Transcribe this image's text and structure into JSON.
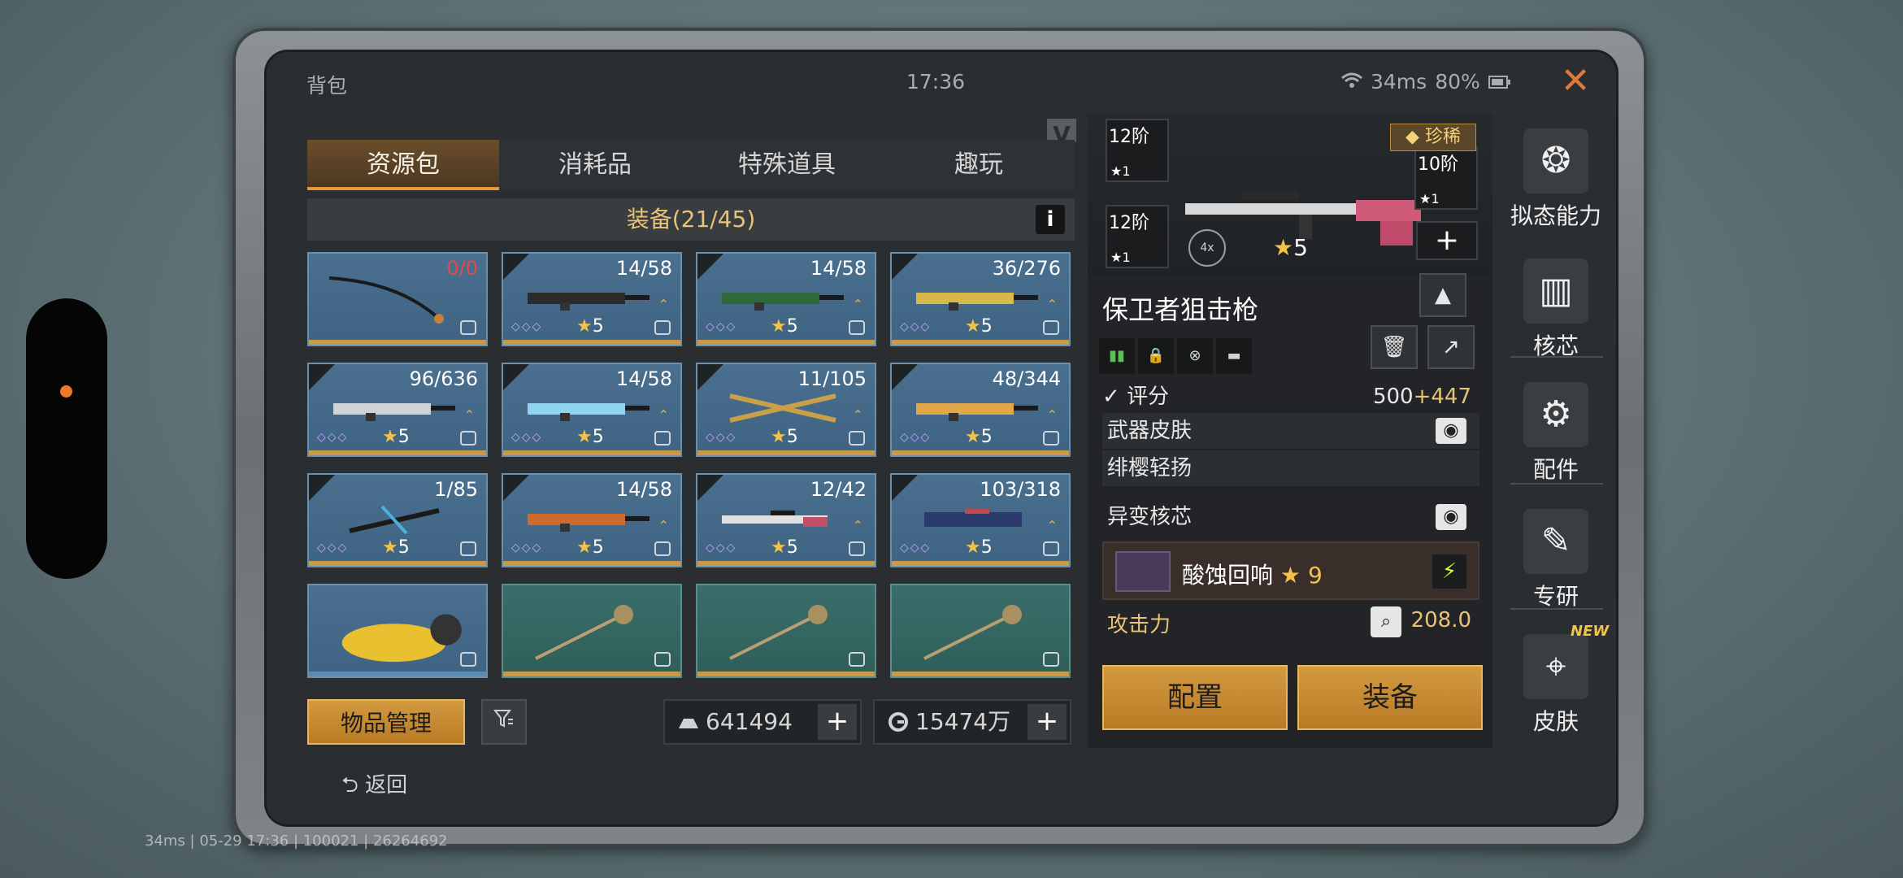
{
  "statusbar": {
    "title": "背包",
    "time": "17:36",
    "ping": "34ms",
    "battery": "80%"
  },
  "icons": {
    "close": "close-icon",
    "wifi": "wifi-icon",
    "battery": "battery-icon",
    "info": "info-icon",
    "filter": "filter-icon",
    "back": "back-arrow-icon",
    "star": "star-icon",
    "lock": "lock-icon"
  },
  "tabs": [
    {
      "label": "资源包",
      "active": true
    },
    {
      "label": "消耗品",
      "active": false
    },
    {
      "label": "特殊道具",
      "active": false
    },
    {
      "label": "趣玩",
      "active": false
    }
  ],
  "equipment_header": "装备(21/45)",
  "info_label": "i",
  "v_badge": "V",
  "items": [
    {
      "count": "0/0",
      "type": "fishing-rod"
    },
    {
      "count": "14/58",
      "stars": "5",
      "type": "rifle"
    },
    {
      "count": "14/58",
      "stars": "5",
      "type": "rifle"
    },
    {
      "count": "36/276",
      "stars": "5",
      "type": "rifle"
    },
    {
      "count": "96/636",
      "stars": "5",
      "type": "rifle"
    },
    {
      "count": "14/58",
      "stars": "5",
      "type": "rifle"
    },
    {
      "count": "11/105",
      "stars": "5",
      "type": "crossbow"
    },
    {
      "count": "48/344",
      "stars": "5",
      "type": "rifle"
    },
    {
      "count": "1/85",
      "stars": "5",
      "type": "crossbow"
    },
    {
      "count": "14/58",
      "stars": "5",
      "type": "rifle"
    },
    {
      "count": "12/42",
      "stars": "5",
      "type": "sniper"
    },
    {
      "count": "103/318",
      "stars": "5",
      "type": "launcher"
    },
    {
      "count": "",
      "type": "scooter"
    },
    {
      "count": "",
      "type": "shovel"
    },
    {
      "count": "",
      "type": "shovel"
    },
    {
      "count": "",
      "type": "shovel"
    }
  ],
  "footer": {
    "manage_label": "物品管理",
    "currency1": "641494",
    "currency2": "15474万",
    "back_label": "返回"
  },
  "weapon": {
    "name": "保卫者狙击枪",
    "rarity": "珍稀",
    "stars": "5",
    "scope": "4x",
    "slot_top_left": {
      "level": "12阶",
      "stars": "1"
    },
    "slot_bottom_left": {
      "level": "12阶",
      "stars": "1"
    },
    "slot_right": {
      "level": "10阶",
      "stars": "1"
    },
    "add_label": "+"
  },
  "details": {
    "score_label": "评分",
    "score_base": "500",
    "score_bonus": "+447",
    "skin_label": "武器皮肤",
    "skin_value": "绯樱轻扬",
    "core_label": "异变核芯",
    "core_name": "酸蚀回响",
    "core_level": "9",
    "attack_label": "攻击力",
    "attack_value": "208.0"
  },
  "actions": {
    "config": "配置",
    "equip": "装备"
  },
  "right_nav": [
    {
      "label": "拟态能力",
      "icon": "beast-icon"
    },
    {
      "label": "核芯",
      "icon": "core-icon"
    },
    {
      "label": "配件",
      "icon": "parts-icon"
    },
    {
      "label": "专研",
      "icon": "research-icon"
    },
    {
      "label": "皮肤",
      "icon": "skin-icon"
    }
  ],
  "new_badge": "NEW",
  "debug_line": "34ms | 05-29 17:36 | 100021 | 26264692",
  "colors": {
    "accent": "#d39a40",
    "tab_active": "#6b4d2a",
    "cell_blue": "#4a6f8f",
    "cell_teal": "#3a6e6a",
    "gold_text": "#e8c277",
    "close": "#e07a3a"
  }
}
